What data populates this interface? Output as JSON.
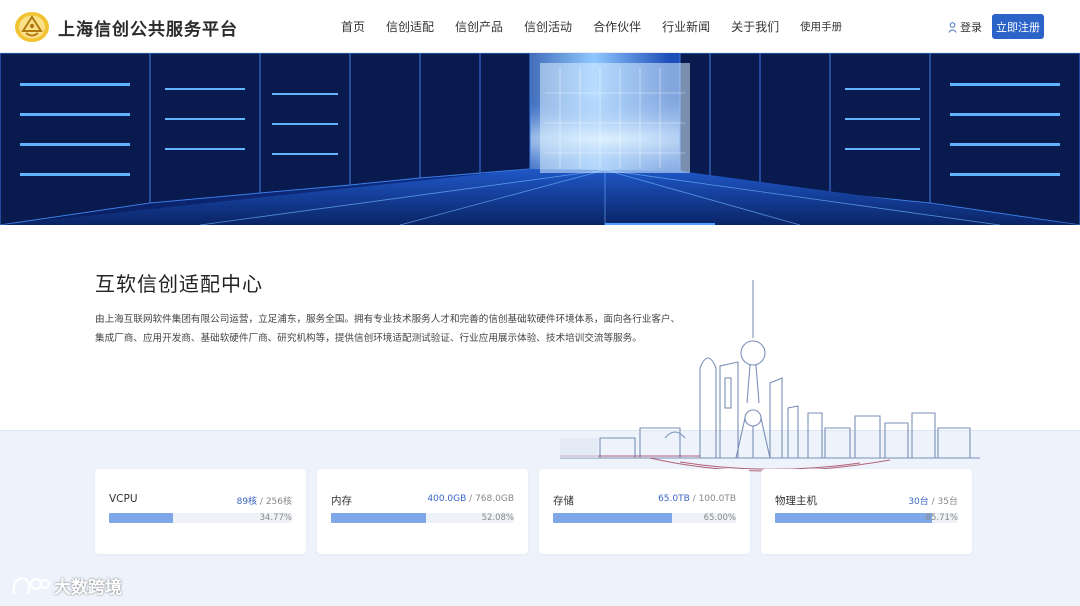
{
  "header": {
    "brand": "上海信创公共服务平台",
    "nav": [
      {
        "label": "首页",
        "name": "nav-home"
      },
      {
        "label": "信创适配",
        "name": "nav-adaptation"
      },
      {
        "label": "信创产品",
        "name": "nav-products"
      },
      {
        "label": "信创活动",
        "name": "nav-activities"
      },
      {
        "label": "合作伙伴",
        "name": "nav-partners"
      },
      {
        "label": "行业新闻",
        "name": "nav-news"
      },
      {
        "label": "关于我们",
        "name": "nav-about"
      },
      {
        "label": "使用手册",
        "name": "nav-manual"
      }
    ],
    "login": "登录",
    "register": "立即注册"
  },
  "intro": {
    "title": "互软信创适配中心",
    "text": "由上海互联网软件集团有限公司运营，立足浦东，服务全国。拥有专业技术服务人才和完善的信创基础软硬件环境体系，面向各行业客户、集成厂商、应用开发商、基础软硬件厂商、研究机构等，提供信创环境适配测试验证、行业应用展示体验、技术培训交流等服务。"
  },
  "resources": [
    {
      "name": "vcpu",
      "label": "VCPU",
      "used": "89核",
      "total": "256核",
      "percent": 34.77,
      "percent_label": "34.77%"
    },
    {
      "name": "memory",
      "label": "内存",
      "used": "400.0GB",
      "total": "768.0GB",
      "percent": 52.08,
      "percent_label": "52.08%"
    },
    {
      "name": "storage",
      "label": "存储",
      "used": "65.0TB",
      "total": "100.0TB",
      "percent": 65.0,
      "percent_label": "65.00%"
    },
    {
      "name": "physical-host",
      "label": "物理主机",
      "used": "30台",
      "total": "35台",
      "percent": 85.71,
      "percent_label": "85.71%"
    }
  ],
  "watermark": "大数跨境",
  "colors": {
    "accent": "#2c63c8",
    "bar_fill": "#7fa6e6",
    "band": "#eef3fb"
  }
}
